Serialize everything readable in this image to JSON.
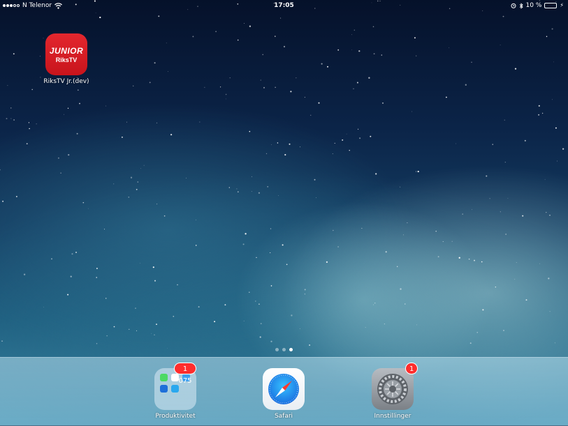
{
  "status_bar": {
    "carrier": "N Telenor",
    "time": "17:05",
    "battery_percent": "10 %",
    "battery_level": 0.1,
    "signal_bars": 3,
    "signal_total": 5
  },
  "home": {
    "apps": [
      {
        "label": "RiksTV Jr.(dev)",
        "icon_line1": "JUNIOR",
        "icon_line2": "RiksTV"
      }
    ],
    "page_count": 3,
    "current_page": 3
  },
  "dock": {
    "folder": {
      "label": "Produktivitet",
      "badge": "1 075"
    },
    "safari": {
      "label": "Safari"
    },
    "settings": {
      "label": "Innstillinger",
      "badge": "1"
    }
  },
  "colors": {
    "badge": "#ff2d2d",
    "riks_red": "#d71920",
    "battery_low": "#ff3b30"
  }
}
